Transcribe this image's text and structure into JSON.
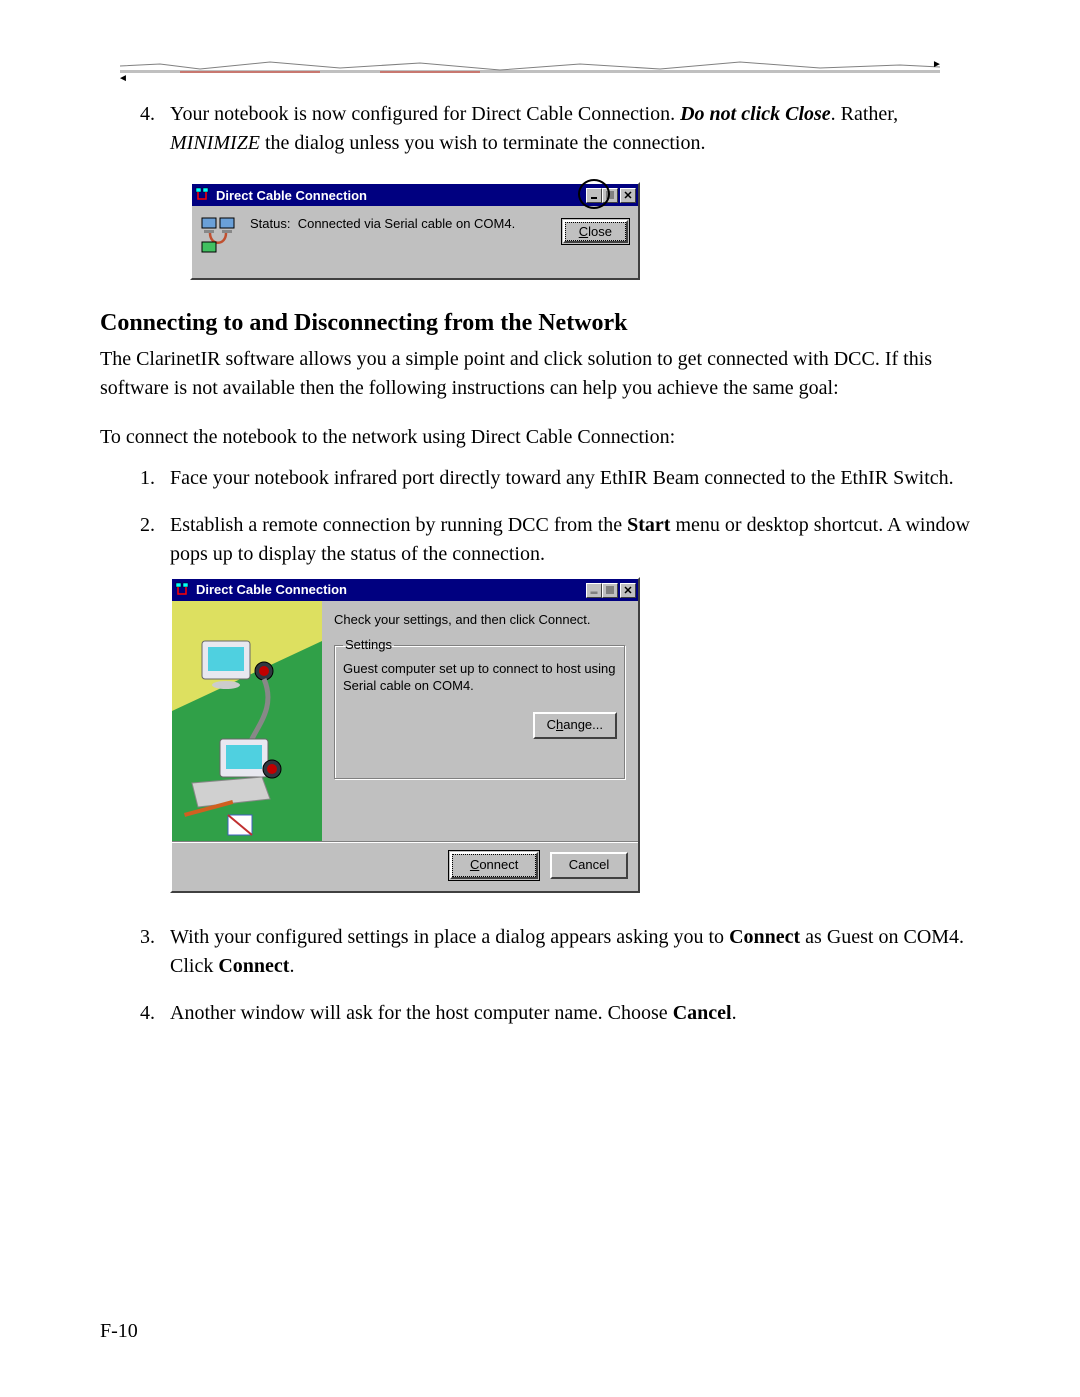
{
  "torn_hint": "decorative torn-edge screenshot fragment",
  "intro_list_start": 4,
  "intro_item4": {
    "prefix": "Your notebook is now configured for Direct Cable Connection. ",
    "em1": "Do not click Close",
    "mid": ".  Rather, ",
    "em2": "MINIMIZE",
    "tail": " the dialog unless you wish to terminate the connection."
  },
  "dlg1": {
    "title": "Direct Cable Connection",
    "status_label": "Status:",
    "status_value": "Connected via Serial cable on COM4.",
    "close_btn": "Close"
  },
  "section_heading": "Connecting to and Disconnecting from the Network",
  "para1": "The ClarinetIR software allows you a simple point and click solution to get connected with DCC.  If this software is not available then the following instructions can help you achieve the same goal:",
  "para2": "To connect the notebook to the network using Direct Cable Connection:",
  "steps": {
    "s1": "Face your notebook infrared port directly toward any EthIR Beam connected to the EthIR Switch.",
    "s2_a": "Establish a remote connection by running DCC from the ",
    "s2_bold": "Start",
    "s2_b": " menu or desktop shortcut.  A window pops up to display the status of the connection.",
    "s3_a": "With your configured settings in place a dialog appears asking you to ",
    "s3_bold1": "Connect",
    "s3_mid": " as Guest on COM4. Click ",
    "s3_bold2": "Connect",
    "s3_tail": ".",
    "s4_a": "Another window will ask for the host computer name.  Choose ",
    "s4_bold": "Cancel",
    "s4_tail": "."
  },
  "dlg2": {
    "title": "Direct Cable Connection",
    "instr": "Check your settings, and then click Connect.",
    "fs_legend": "Settings",
    "fs_text": "Guest computer set up to connect to host using Serial cable on COM4.",
    "change_btn": "Change...",
    "connect_btn": "Connect",
    "cancel_btn": "Cancel"
  },
  "page_number": "F-10"
}
